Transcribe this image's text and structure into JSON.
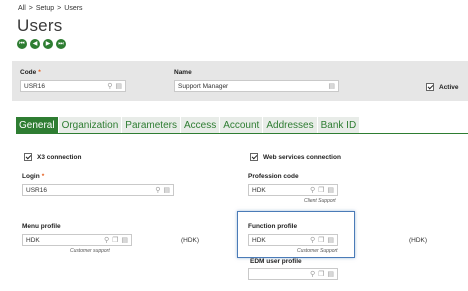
{
  "breadcrumb": [
    "All",
    "Setup",
    "Users"
  ],
  "breadcrumb_sep": ">",
  "title": "Users",
  "nav_icons": [
    "first-icon",
    "previous-icon",
    "next-icon",
    "last-icon"
  ],
  "nav_glyphs": [
    "⏮",
    "◀",
    "▶",
    "⏭"
  ],
  "header": {
    "code_label": "Code",
    "code_value": "USR16",
    "name_label": "Name",
    "name_value": "Support Manager",
    "active_label": "Active",
    "active_checked": true
  },
  "required_mark": "*",
  "tabs": [
    {
      "label": "General",
      "active": true
    },
    {
      "label": "Organization",
      "active": false
    },
    {
      "label": "Parameters",
      "active": false
    },
    {
      "label": "Access",
      "active": false
    },
    {
      "label": "Account",
      "active": false
    },
    {
      "label": "Addresses",
      "active": false
    },
    {
      "label": "Bank ID",
      "active": false
    }
  ],
  "general": {
    "x3_connection_label": "X3 connection",
    "web_services_label": "Web services connection",
    "login_label": "Login",
    "login_value": "USR16",
    "profession_code_label": "Profession code",
    "profession_code_value": "HDK",
    "profession_code_desc": "Client Support",
    "menu_profile_label": "Menu profile",
    "menu_profile_value": "HDK",
    "menu_profile_desc": "Customer support",
    "menu_profile_code": "(HDK)",
    "function_profile_label": "Function profile",
    "function_profile_value": "HDK",
    "function_profile_desc": "Customer Support",
    "function_profile_code": "(HDK)",
    "edm_user_profile_label": "EDM user profile",
    "edm_user_profile_value": ""
  },
  "colors": {
    "accent": "#2e7d32",
    "required": "#e55b1a",
    "focus": "#4a7bb7",
    "header_band": "#e6e6e6"
  }
}
